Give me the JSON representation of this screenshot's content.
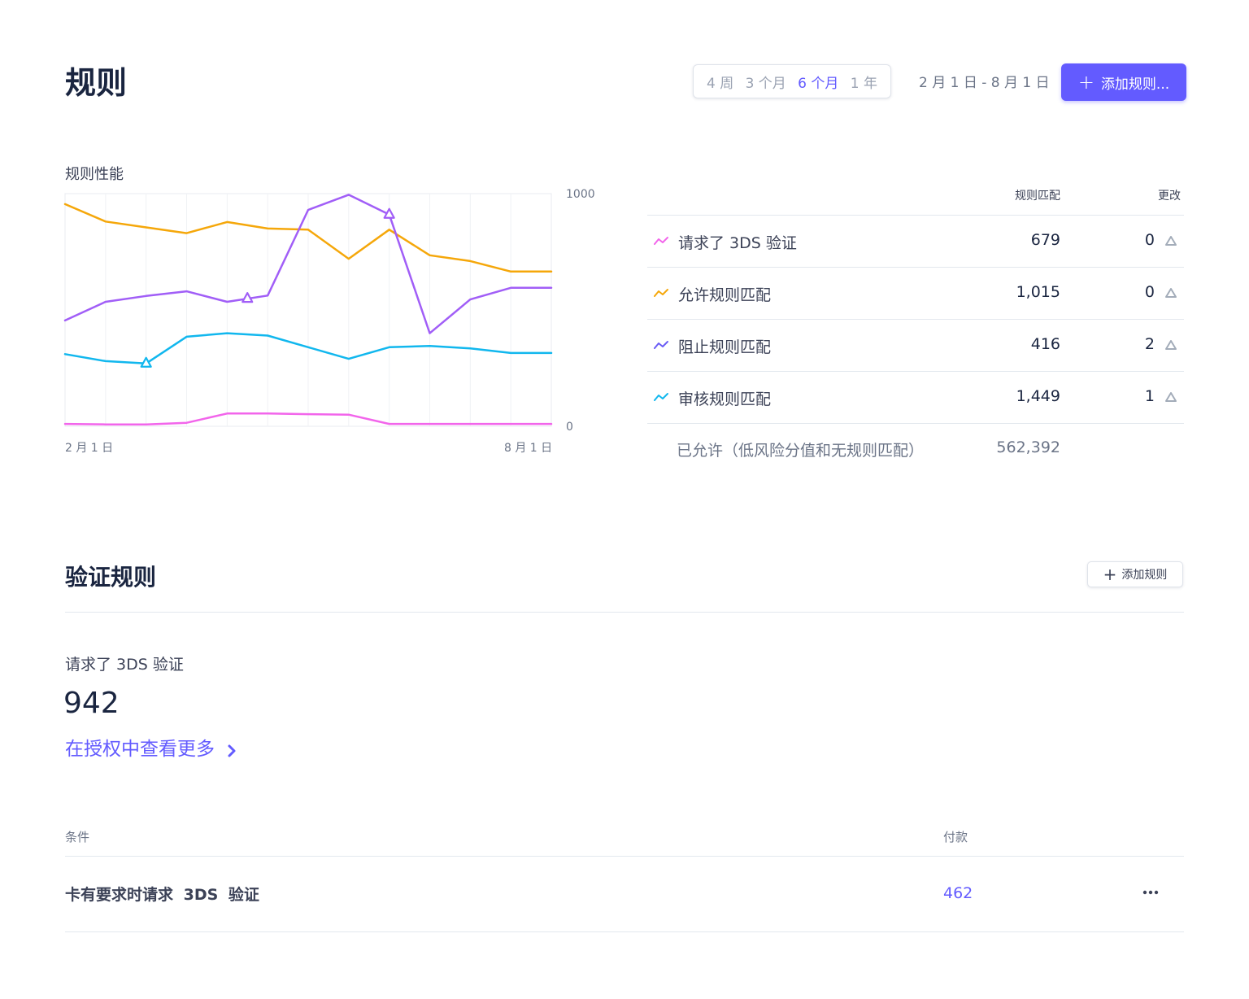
{
  "header": {
    "title": "规则",
    "range_options": [
      {
        "label": "4 周",
        "active": false
      },
      {
        "label": "3 个月",
        "active": false
      },
      {
        "label": "6 个月",
        "active": true
      },
      {
        "label": "1 年",
        "active": false
      }
    ],
    "date_range": "2 月 1 日 - 8 月 1 日",
    "add_rule_label": "添加规则..."
  },
  "performance": {
    "title": "规则性能",
    "date_start": "2 月 1 日",
    "date_end": "8 月 1 日"
  },
  "chart_data": {
    "type": "line",
    "title": "规则性能",
    "x": [
      "2 月 1 日",
      "",
      "",
      "",
      "",
      "",
      "",
      "",
      "",
      "",
      "",
      "",
      "8 月 1 日"
    ],
    "ylim": [
      0,
      1000
    ],
    "yticks": [
      0,
      1000
    ],
    "grid": true,
    "series": [
      {
        "color": "#f5a70a",
        "values": [
          955,
          880,
          855,
          830,
          878,
          850,
          845,
          720,
          845,
          735,
          710,
          665,
          665
        ]
      },
      {
        "color": "#a15ef7",
        "values": [
          455,
          535,
          560,
          580,
          535,
          562,
          930,
          995,
          910,
          400,
          545,
          595,
          595
        ]
      },
      {
        "color": "#11b7ee",
        "values": [
          310,
          280,
          270,
          385,
          400,
          390,
          340,
          290,
          340,
          345,
          335,
          315,
          315
        ]
      },
      {
        "color": "#f265eb",
        "values": [
          10,
          8,
          8,
          15,
          55,
          55,
          52,
          50,
          10,
          10,
          10,
          10,
          10
        ]
      }
    ],
    "markers": [
      {
        "series": 2,
        "index": 2
      },
      {
        "series": 1,
        "index": 4.5
      },
      {
        "series": 1,
        "index": 8
      }
    ]
  },
  "stats": {
    "header_matches": "规则匹配",
    "header_change": "更改",
    "rows": [
      {
        "label": "请求了 3DS 验证",
        "matches": "679",
        "change": "0",
        "color": "#f265eb"
      },
      {
        "label": "允许规则匹配",
        "matches": "1,015",
        "change": "0",
        "color": "#f5a70a"
      },
      {
        "label": "阻止规则匹配",
        "matches": "416",
        "change": "2",
        "color": "#6a5cf5"
      },
      {
        "label": "审核规则匹配",
        "matches": "1,449",
        "change": "1",
        "color": "#11b7ee"
      }
    ],
    "footer_label": "已允许（低风险分值和无规则匹配）",
    "footer_matches": "562,392"
  },
  "verification": {
    "title": "验证规则",
    "add_rule_label": "添加规则",
    "metric_label": "请求了 3DS 验证",
    "metric_value": "942",
    "view_more_label": "在授权中查看更多"
  },
  "conditions": {
    "header_condition": "条件",
    "header_payments": "付款",
    "rows": [
      {
        "condition": "卡有要求时请求 3DS 验证",
        "payments": "462"
      }
    ]
  },
  "colors": {
    "accent": "#635bff",
    "text_dark": "#1a2540",
    "text_muted": "#6b7487",
    "border": "#e3e8ee"
  }
}
